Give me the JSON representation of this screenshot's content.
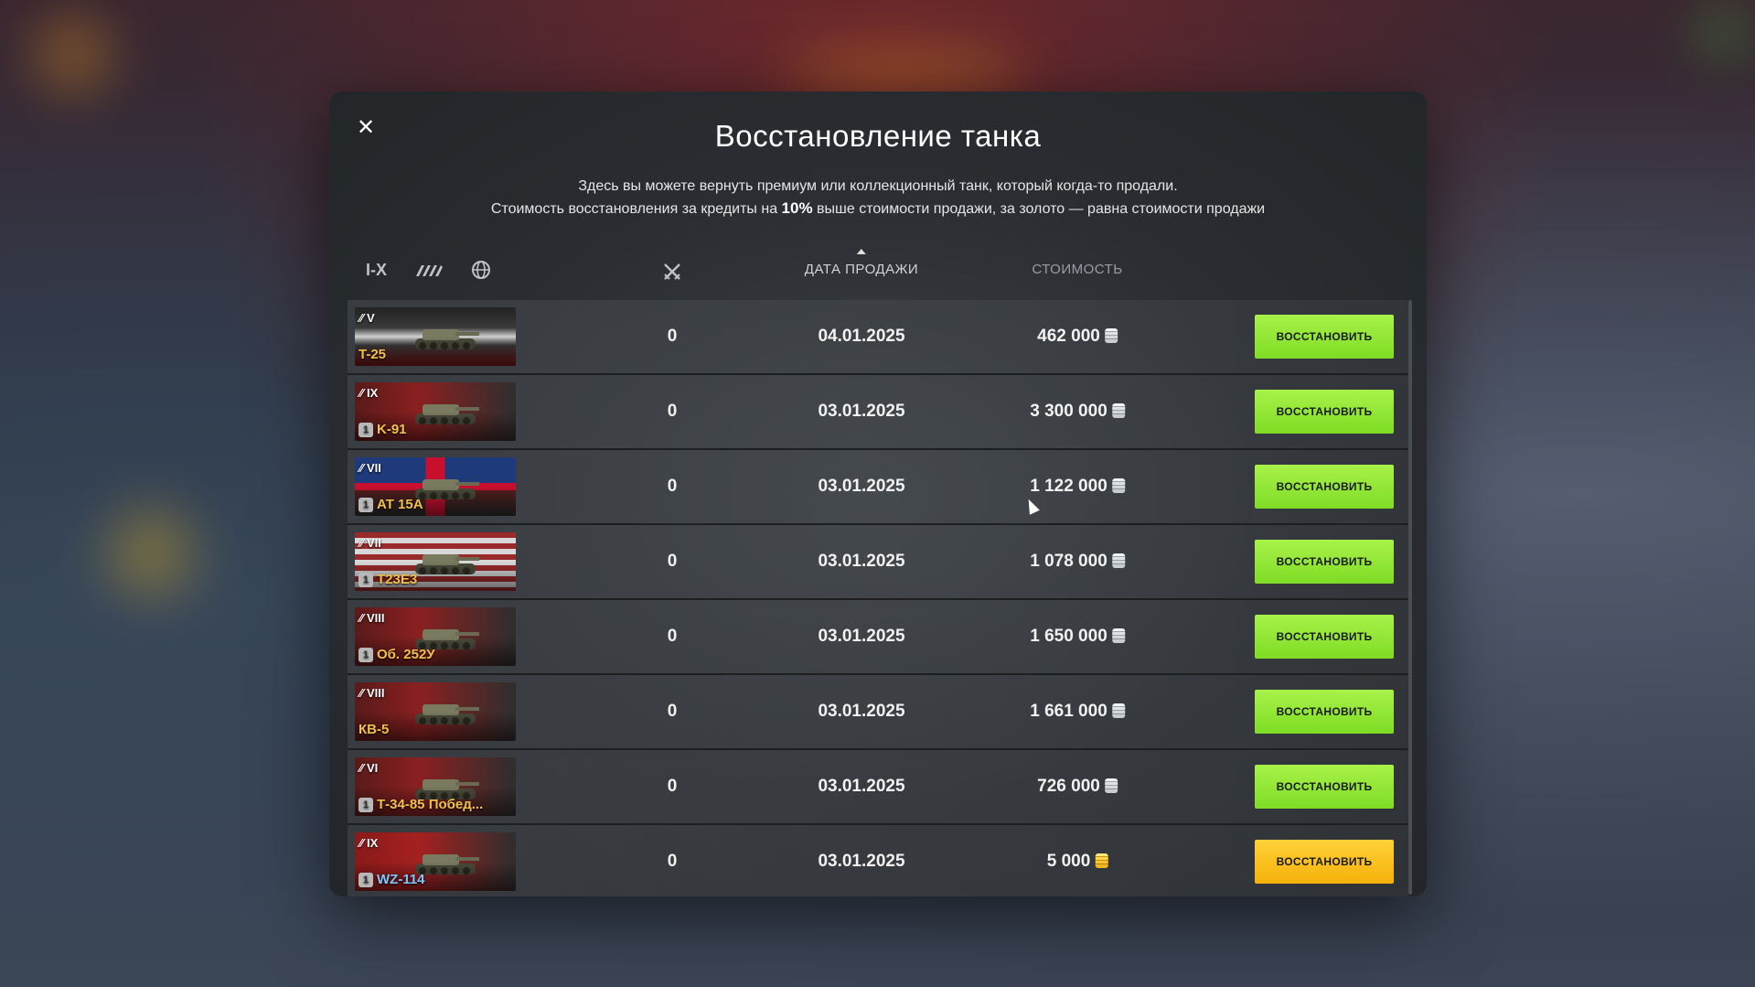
{
  "modal": {
    "title": "Восстановление танка",
    "desc_line1": "Здесь вы можете вернуть премиум или коллекционный танк, который когда-то продали.",
    "desc_line2_pre": "Стоимость восстановления за кредиты на ",
    "desc_line2_bold": "10%",
    "desc_line2_post": " выше стоимости продажи, за золото — равна стоимости продажи",
    "close_icon": "close-icon"
  },
  "filters": {
    "tier_label": "I-X",
    "type_icon": "tank-type-icon",
    "nation_icon": "globe-icon",
    "battles_icon": "crossed-swords-icon"
  },
  "columns": {
    "date": "ДАТА ПРОДАЖИ",
    "cost": "СТОИМОСТЬ"
  },
  "colors": {
    "credit_button": "#8ee232",
    "gold_button": "#fbc21a",
    "tank_name_gold": "#f3c04a",
    "tank_name_blue": "#7ec9ff"
  },
  "tanks": [
    {
      "tier": "V",
      "name": "T-25",
      "nation": "germany",
      "battles": "0",
      "date": "04.01.2025",
      "cost": "462 000",
      "currency": "credits",
      "button": "ВОССТАНОВИТЬ"
    },
    {
      "tier": "IX",
      "name": "K-91",
      "nation": "ussr",
      "badge": "1",
      "battles": "0",
      "date": "03.01.2025",
      "cost": "3 300 000",
      "currency": "credits",
      "button": "ВОССТАНОВИТЬ"
    },
    {
      "tier": "VII",
      "name": "AT 15A",
      "nation": "uk",
      "badge": "1",
      "battles": "0",
      "date": "03.01.2025",
      "cost": "1 122 000",
      "currency": "credits",
      "button": "ВОССТАНОВИТЬ"
    },
    {
      "tier": "VII",
      "name": "T23E3",
      "nation": "usa",
      "badge": "1",
      "battles": "0",
      "date": "03.01.2025",
      "cost": "1 078 000",
      "currency": "credits",
      "button": "ВОССТАНОВИТЬ"
    },
    {
      "tier": "VIII",
      "name": "Об. 252У",
      "nation": "ussr",
      "badge": "1",
      "battles": "0",
      "date": "03.01.2025",
      "cost": "1 650 000",
      "currency": "credits",
      "button": "ВОССТАНОВИТЬ"
    },
    {
      "tier": "VIII",
      "name": "КВ-5",
      "nation": "ussr",
      "battles": "0",
      "date": "03.01.2025",
      "cost": "1 661 000",
      "currency": "credits",
      "button": "ВОССТАНОВИТЬ"
    },
    {
      "tier": "VI",
      "name": "Т-34-85 Побед...",
      "nation": "ussr",
      "badge": "1",
      "battles": "0",
      "date": "03.01.2025",
      "cost": "726 000",
      "currency": "credits",
      "button": "ВОССТАНОВИТЬ"
    },
    {
      "tier": "IX",
      "name": "WZ-114",
      "nation": "china",
      "badge": "1",
      "battles": "0",
      "date": "03.01.2025",
      "cost": "5 000",
      "currency": "gold",
      "button": "ВОССТАНОВИТЬ"
    }
  ]
}
